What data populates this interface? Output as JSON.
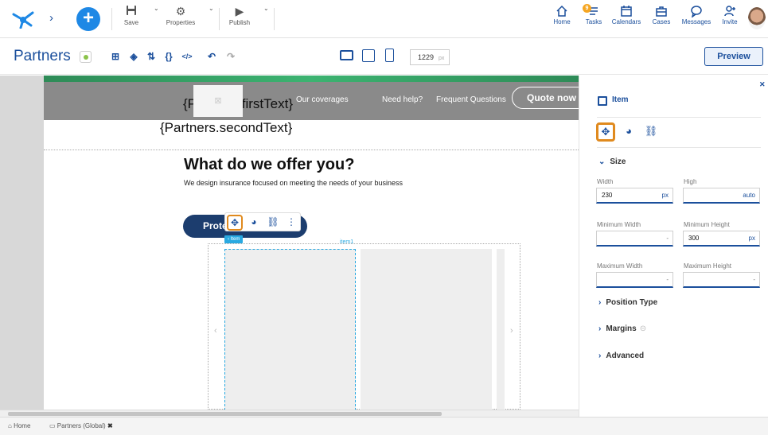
{
  "header": {
    "tools": [
      {
        "label": "Save",
        "icon": "save-icon"
      },
      {
        "label": "Properties",
        "icon": "gear-icon"
      },
      {
        "label": "Publish",
        "icon": "play-icon"
      }
    ],
    "nav": [
      {
        "label": "Home",
        "icon": "home-icon"
      },
      {
        "label": "Tasks",
        "icon": "tasks-icon",
        "badge": "9"
      },
      {
        "label": "Calendars",
        "icon": "calendar-icon"
      },
      {
        "label": "Cases",
        "icon": "briefcase-icon"
      },
      {
        "label": "Messages",
        "icon": "chat-icon"
      },
      {
        "label": "Invite",
        "icon": "invite-icon"
      }
    ]
  },
  "toolbar": {
    "title": "Partners",
    "width_value": "1229",
    "width_unit": "px",
    "preview_label": "Preview"
  },
  "canvas": {
    "nav_links": [
      "Our coverages",
      "Need help?",
      "Frequent Questions"
    ],
    "quote_btn": "Quote now",
    "text_a_prefix": "{P",
    "text_a_suffix": ".firstText}",
    "text_b": "{Partners.secondText}",
    "offer_title": "What do we offer you?",
    "offer_sub": "We design insurance focused on meeting the needs of your business",
    "protect_btn": "Prote",
    "item_tag": "‹ Item",
    "item1_label": "item1"
  },
  "panel": {
    "item_label": "Item",
    "sections": {
      "size": "Size",
      "position_type": "Position Type",
      "margins": "Margins",
      "advanced": "Advanced"
    },
    "fields": {
      "width_label": "Width",
      "width_value": "230",
      "width_unit": "px",
      "high_label": "High",
      "high_value": "auto",
      "min_width_label": "Minimum Width",
      "min_width_value": "-",
      "min_height_label": "Minimum Height",
      "min_height_value": "300",
      "min_height_unit": "px",
      "max_width_label": "Maximum Width",
      "max_width_value": "-",
      "max_height_label": "Maximum Height",
      "max_height_value": "-"
    }
  },
  "bottom": {
    "home_tab": "Home",
    "partners_tab": "Partners (Global)"
  },
  "colors": {
    "primary": "#1b4f9c",
    "accent_orange": "#e08a1e",
    "plus_blue": "#1e88e5",
    "item_blue": "#29a9e1",
    "protect_navy": "#1c3d6e"
  }
}
